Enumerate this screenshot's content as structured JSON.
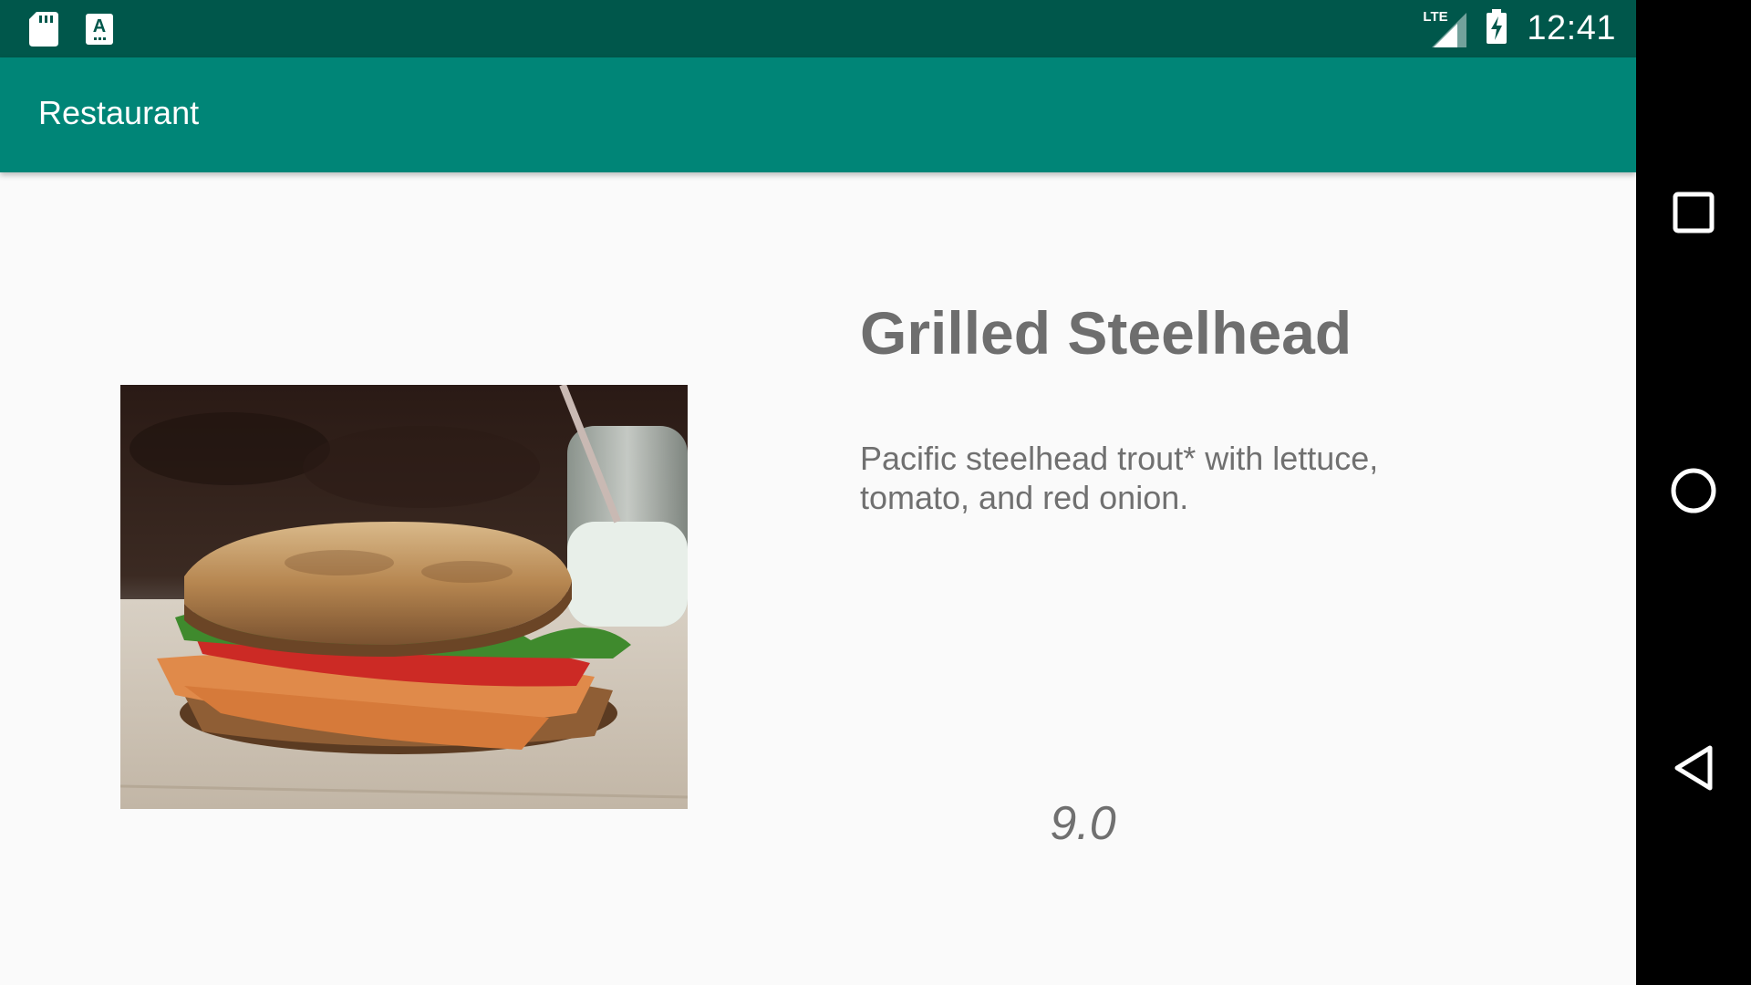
{
  "status_bar": {
    "time": "12:41",
    "network_label": "LTE",
    "icons": [
      "sd-card-icon",
      "keyboard-a-icon",
      "lte-signal-icon",
      "battery-charging-icon"
    ]
  },
  "app_bar": {
    "title": "Restaurant",
    "color": "#008577",
    "status_color": "#00574b"
  },
  "dish": {
    "name": "Grilled Steelhead",
    "description": "Pacific steelhead trout* with lettuce, tomato, and red onion.",
    "rating": "9.0",
    "image_icon": "sandwich-photo"
  },
  "nav_bar": {
    "buttons": [
      "recents-icon",
      "home-icon",
      "back-icon"
    ]
  }
}
